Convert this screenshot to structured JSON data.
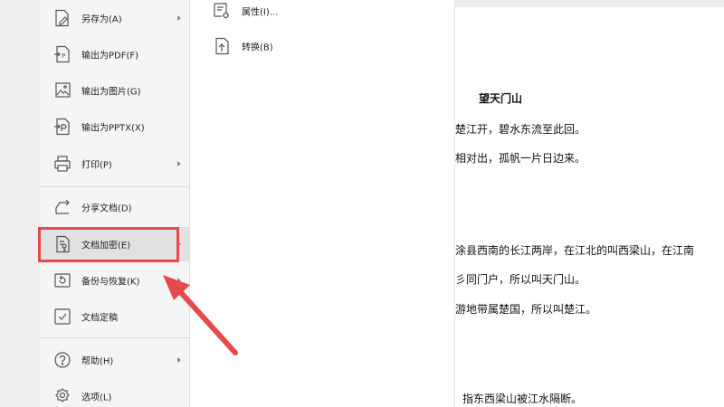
{
  "menu": {
    "items": [
      {
        "label": "另存为(A)",
        "icon": "save-as-icon",
        "has_submenu": true
      },
      {
        "label": "输出为PDF(F)",
        "icon": "export-pdf-icon",
        "has_submenu": false
      },
      {
        "label": "输出为图片(G)",
        "icon": "export-image-icon",
        "has_submenu": false
      },
      {
        "label": "输出为PPTX(X)",
        "icon": "export-pptx-icon",
        "has_submenu": false
      },
      {
        "label": "打印(P)",
        "icon": "print-icon",
        "has_submenu": true
      },
      {
        "label": "分享文档(D)",
        "icon": "share-icon",
        "has_submenu": false
      },
      {
        "label": "文档加密(E)",
        "icon": "encrypt-icon",
        "has_submenu": true,
        "highlighted": true
      },
      {
        "label": "备份与恢复(K)",
        "icon": "backup-icon",
        "has_submenu": true
      },
      {
        "label": "文档定稿",
        "icon": "finalize-icon",
        "has_submenu": false
      },
      {
        "label": "帮助(H)",
        "icon": "help-icon",
        "has_submenu": true
      },
      {
        "label": "选项(L)",
        "icon": "settings-icon",
        "has_submenu": false
      }
    ]
  },
  "submenu": {
    "items": [
      {
        "label": "属性(I)...",
        "icon": "properties-icon"
      },
      {
        "label": "转换(B)",
        "icon": "convert-icon"
      }
    ]
  },
  "document": {
    "title": "望天门山",
    "lines": [
      "楚江开，碧水东流至此回。",
      "相对出，孤帆一片日边来。",
      "涂县西南的长江两岸，在江北的叫西梁山，在江南",
      "彡同门户，所以叫天门山。",
      "游地带属楚国，所以叫楚江。",
      "指东西梁山被江水隔断。"
    ]
  },
  "colors": {
    "annotation_red": "#e74a4a",
    "menu_bg": "#f5f5f5",
    "highlight_bg": "#e1e1e1"
  }
}
